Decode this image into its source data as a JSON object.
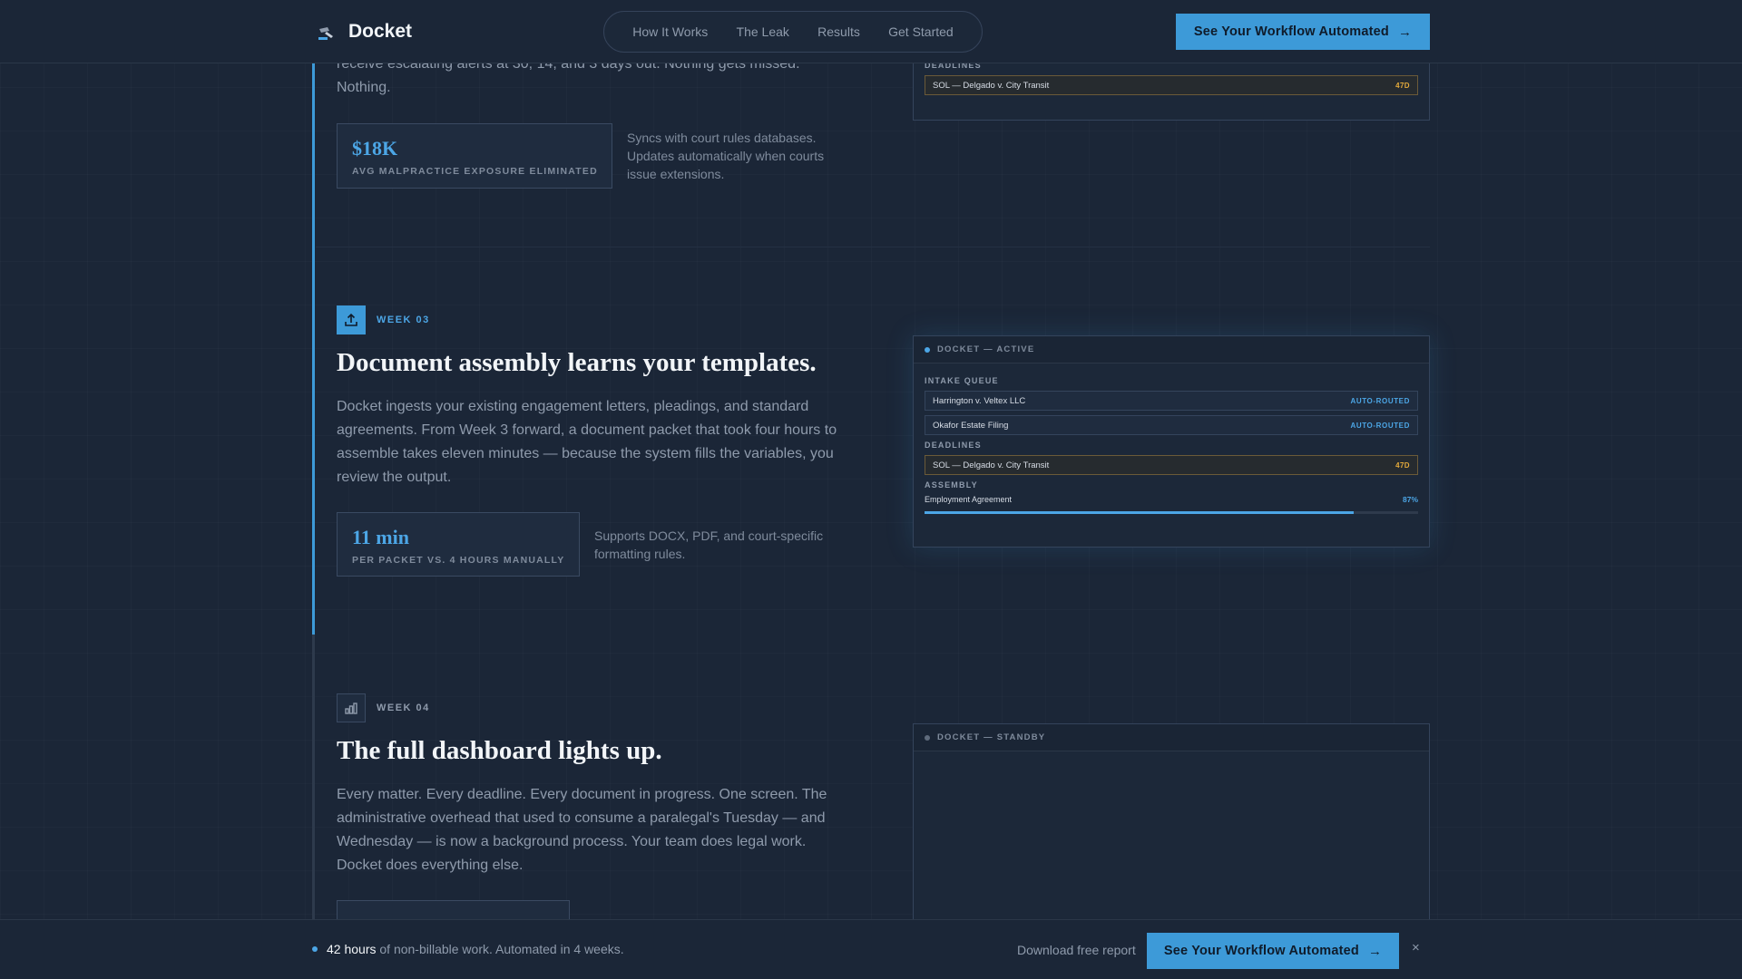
{
  "header": {
    "brand_name": "Docket",
    "nav": [
      "How It Works",
      "The Leak",
      "Results",
      "Get Started"
    ],
    "cta_label": "See Your Workflow Automated",
    "cta_arrow": "→"
  },
  "prev_section": {
    "text": "receive escalating alerts at 30, 14, and 3 days out. Nothing gets missed. Nothing.",
    "stat_value": "$18K",
    "stat_label": "AVG MALPRACTICE EXPOSURE ELIMINATED",
    "stat_note": "Syncs with court rules databases. Updates automatically when courts issue extensions.",
    "panel": {
      "deadlines_label": "DEADLINES",
      "deadline_item": "SOL — Delgado v. City Transit",
      "deadline_tag": "47D"
    }
  },
  "week3": {
    "label": "WEEK 03",
    "heading": "Document assembly learns your templates.",
    "paragraph": "Docket ingests your existing engagement letters, pleadings, and standard agreements. From Week 3 forward, a document packet that took four hours to assemble takes eleven minutes — because the system fills the variables, you review the output.",
    "stat_value": "11 min",
    "stat_label": "PER PACKET VS. 4 HOURS MANUALLY",
    "stat_note": "Supports DOCX, PDF, and court-specific formatting rules.",
    "panel": {
      "title": "DOCKET — ACTIVE",
      "intake_label": "INTAKE QUEUE",
      "intake_items": [
        {
          "name": "Harrington v. Veltex LLC",
          "tag": "AUTO-ROUTED"
        },
        {
          "name": "Okafor Estate Filing",
          "tag": "AUTO-ROUTED"
        }
      ],
      "deadlines_label": "DEADLINES",
      "deadline_item": "SOL — Delgado v. City Transit",
      "deadline_tag": "47D",
      "assembly_label": "ASSEMBLY",
      "assembly_item": "Employment Agreement",
      "assembly_pct": "87%",
      "assembly_fraction": 0.87
    }
  },
  "week4": {
    "label": "WEEK 04",
    "heading": "The full dashboard lights up.",
    "paragraph": "Every matter. Every deadline. Every document in progress. One screen. The administrative overhead that used to consume a paralegal's Tuesday — and Wednesday — is now a background process. Your team does legal work. Docket does everything else.",
    "panel": {
      "title": "DOCKET — STANDBY"
    }
  },
  "bottom_bar": {
    "strong": "42 hours",
    "rest": "of non-billable work. Automated in 4 weeks.",
    "download_label": "Download free report",
    "cta_label": "See Your Workflow Automated",
    "cta_arrow": "→",
    "close": "×"
  },
  "colors": {
    "accent": "#3d9ad8",
    "background": "#1b2637",
    "warning": "#e2a93b"
  }
}
